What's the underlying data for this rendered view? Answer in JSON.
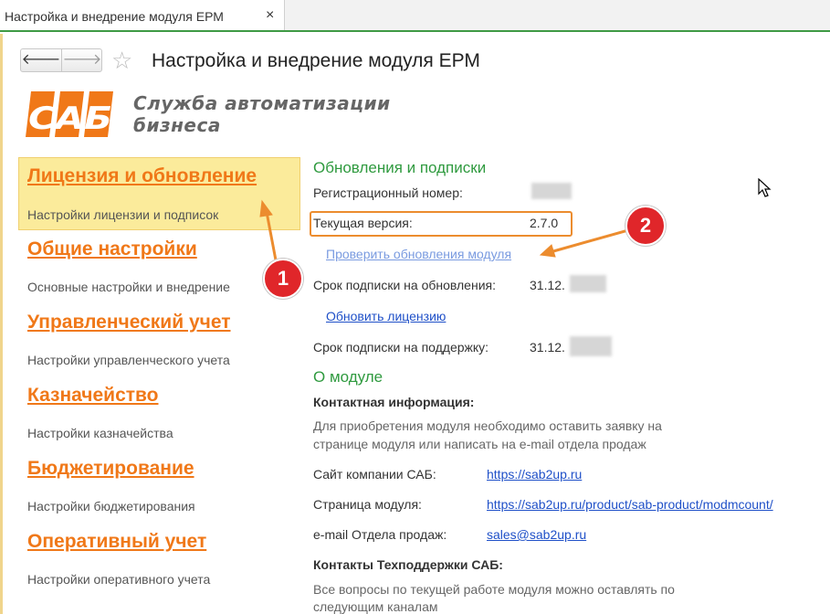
{
  "tab": {
    "label": "Настройка и внедрение модуля ЕРМ",
    "close": "×"
  },
  "toolbar": {
    "back": "🡐",
    "forward": "🡒",
    "favorite": "☆",
    "title": "Настройка и внедрение модуля ЕРМ"
  },
  "logo": {
    "mark": "САБ",
    "text": "Служба автоматизации\nбизнеса"
  },
  "nav": [
    {
      "title": "Лицензия и обновление",
      "subtitle": "Настройки лицензии и подписок"
    },
    {
      "title": "Общие настройки",
      "subtitle": "Основные настройки и внедрение"
    },
    {
      "title": "Управленческий учет",
      "subtitle": "Настройки управленческого учета"
    },
    {
      "title": "Казначейство",
      "subtitle": "Настройки казначейства"
    },
    {
      "title": "Бюджетирование",
      "subtitle": "Настройки бюджетирования"
    },
    {
      "title": "Оперативный учет",
      "subtitle": "Настройки оперативного учета"
    }
  ],
  "updates": {
    "heading": "Обновления и подписки",
    "reg_label": "Регистрационный номер:",
    "version_label": "Текущая версия:",
    "version_value": "2.7.0",
    "check_link": "Проверить обновления модуля",
    "sub_updates_label": "Срок подписки на обновления:",
    "sub_updates_value": "31.12.",
    "renew_link": "Обновить лицензию",
    "sub_support_label": "Срок подписки на поддержку:",
    "sub_support_value": "31.12."
  },
  "about": {
    "heading": "О модуле",
    "contact_heading": "Контактная информация:",
    "contact_text_1": "Для приобретения модуля необходимо оставить заявку на",
    "contact_text_2": "странице модуля или написать на e-mail отдела продаж",
    "site_label": "Сайт компании САБ:",
    "site_link": "https://sab2up.ru",
    "module_label": "Страница модуля:",
    "module_link": "https://sab2up.ru/product/sab-product/modmcount/",
    "email_label": "e-mail Отдела продаж:",
    "email_link": "sales@sab2up.ru",
    "support_heading": "Контакты Техподдержки САБ:",
    "support_text_1": "Все вопросы по текущей работе модуля можно  оставлять по",
    "support_text_2": "следующим каналам"
  },
  "annotations": {
    "one": "1",
    "two": "2"
  },
  "colors": {
    "accent": "#f07818",
    "green": "#2f9a3f",
    "link": "#1f50c8",
    "marker": "#e0262a",
    "highlight": "#fbeb9b"
  }
}
